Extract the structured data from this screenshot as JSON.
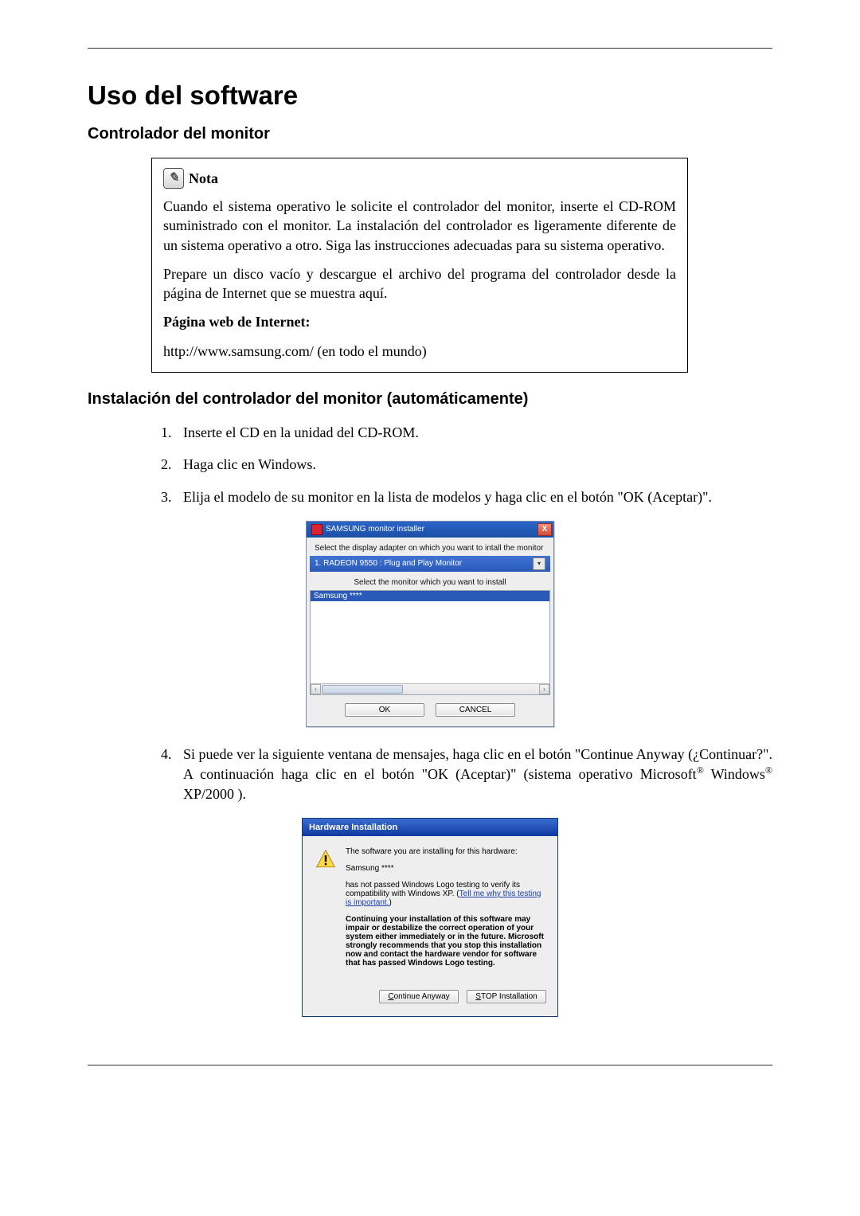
{
  "h1": "Uso del software",
  "h2_1": "Controlador del monitor",
  "note": {
    "title": "Nota",
    "p1": "Cuando el sistema operativo le solicite el controlador del monitor, inserte el CD-ROM suministrado con el monitor. La instalación del controlador es ligeramente diferente de un sistema operativo a otro. Siga las instrucciones adecuadas para su sistema operativo.",
    "p2": "Prepare un disco vacío y descargue el archivo del programa del controlador desde la página de Internet que se muestra aquí.",
    "bold_line": "Página web de Internet:",
    "url_line": "http://www.samsung.com/ (en todo el mundo)"
  },
  "h2_2": "Instalación del controlador del monitor (automáticamente)",
  "steps": {
    "s1": "Inserte el CD en la unidad del CD-ROM.",
    "s2": "Haga clic en Windows.",
    "s3": "Elija el modelo de su monitor en la lista de modelos y haga clic en el botón \"OK (Aceptar)\".",
    "s4": {
      "p1a": "Si puede ver la siguiente ventana de mensajes, haga clic en el botón \"Continue Anyway (¿Continuar?\". A continuación haga clic en el botón \"OK (Aceptar)\" (sistema operativo Microsoft",
      "p1b": " Windows",
      "p1c": " XP/2000 )."
    }
  },
  "shot1": {
    "title": "SAMSUNG monitor installer",
    "close": "X",
    "instr1": "Select the display adapter on which you want to intall the monitor",
    "adapter": "1. RADEON 9550 : Plug and Play Monitor",
    "drop": "▾",
    "instr2": "Select the monitor which you want to install",
    "selected": "Samsung ****",
    "arr_l": "‹",
    "arr_r": "›",
    "ok": "OK",
    "cancel": "CANCEL"
  },
  "shot2": {
    "title": "Hardware Installation",
    "p1": "The software you are installing for this hardware:",
    "p2": "Samsung ****",
    "p3a": "has not passed Windows Logo testing to verify its compatibility with Windows XP. (",
    "p3link": "Tell me why this testing is important.",
    "p3b": ")",
    "p4": "Continuing your installation of this software may impair or destabilize the correct operation of your system either immediately or in the future. Microsoft strongly recommends that you stop this installation now and contact the hardware vendor for software that has passed Windows Logo testing.",
    "btn_continue_u": "C",
    "btn_continue_rest": "ontinue Anyway",
    "btn_stop_u": "S",
    "btn_stop_rest": "TOP Installation"
  }
}
